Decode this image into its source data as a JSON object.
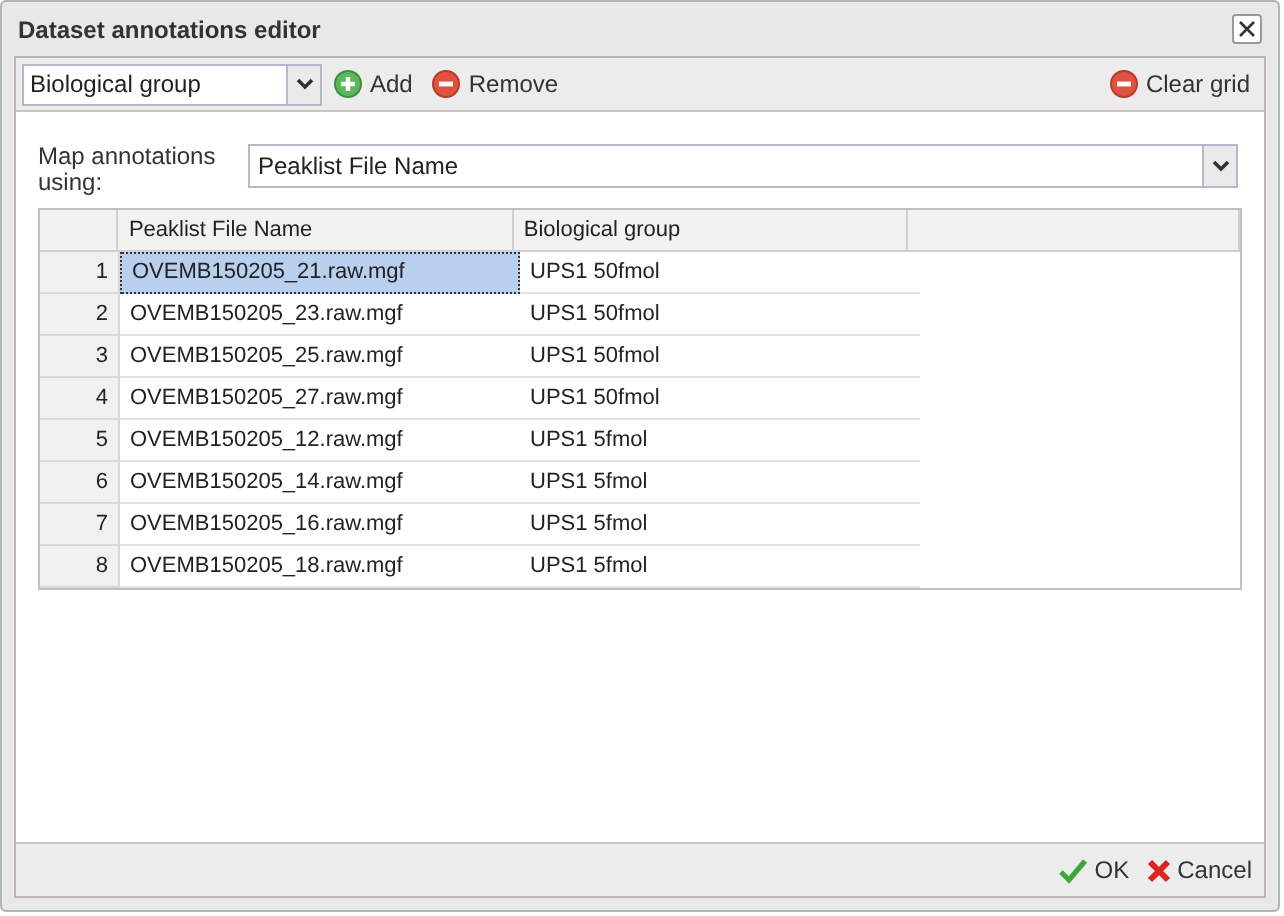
{
  "window": {
    "title": "Dataset annotations editor"
  },
  "toolbar": {
    "annotation_select": "Biological group",
    "add": "Add",
    "remove": "Remove",
    "clear": "Clear grid"
  },
  "map": {
    "label": "Map annotations using:",
    "value": "Peaklist File Name"
  },
  "table": {
    "columns": [
      "Peaklist File Name",
      "Biological group"
    ],
    "rows": [
      {
        "number": "1",
        "cells": [
          "OVEMB150205_21.raw.mgf",
          "UPS1 50fmol"
        ],
        "selected": true
      },
      {
        "number": "2",
        "cells": [
          "OVEMB150205_23.raw.mgf",
          "UPS1 50fmol"
        ],
        "selected": false
      },
      {
        "number": "3",
        "cells": [
          "OVEMB150205_25.raw.mgf",
          "UPS1 50fmol"
        ],
        "selected": false
      },
      {
        "number": "4",
        "cells": [
          "OVEMB150205_27.raw.mgf",
          "UPS1 50fmol"
        ],
        "selected": false
      },
      {
        "number": "5",
        "cells": [
          "OVEMB150205_12.raw.mgf",
          "UPS1 5fmol"
        ],
        "selected": false
      },
      {
        "number": "6",
        "cells": [
          "OVEMB150205_14.raw.mgf",
          "UPS1 5fmol"
        ],
        "selected": false
      },
      {
        "number": "7",
        "cells": [
          "OVEMB150205_16.raw.mgf",
          "UPS1 5fmol"
        ],
        "selected": false
      },
      {
        "number": "8",
        "cells": [
          "OVEMB150205_18.raw.mgf",
          "UPS1 5fmol"
        ],
        "selected": false
      }
    ]
  },
  "footer": {
    "ok": "OK",
    "cancel": "Cancel"
  }
}
